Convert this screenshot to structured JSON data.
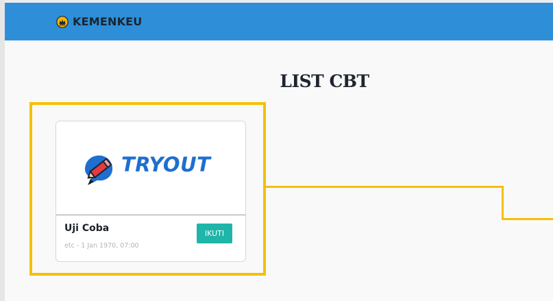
{
  "header": {
    "brand": "KEMENKEU",
    "brand_icon": "kemenkeu-emblem-icon"
  },
  "main": {
    "title": "LIST CBT",
    "cards": [
      {
        "image_text": "TRYOUT",
        "image_icon": "pencil-bubble-icon",
        "title": "Uji Coba",
        "meta": "etc - 1 Jan 1970, 07:00",
        "button_label": "IKUTI"
      }
    ]
  },
  "colors": {
    "header": "#2e8fd8",
    "highlight": "#f5c000",
    "button": "#1fb5a9",
    "logo_blue": "#1e6fcf",
    "logo_red": "#e23b44"
  }
}
